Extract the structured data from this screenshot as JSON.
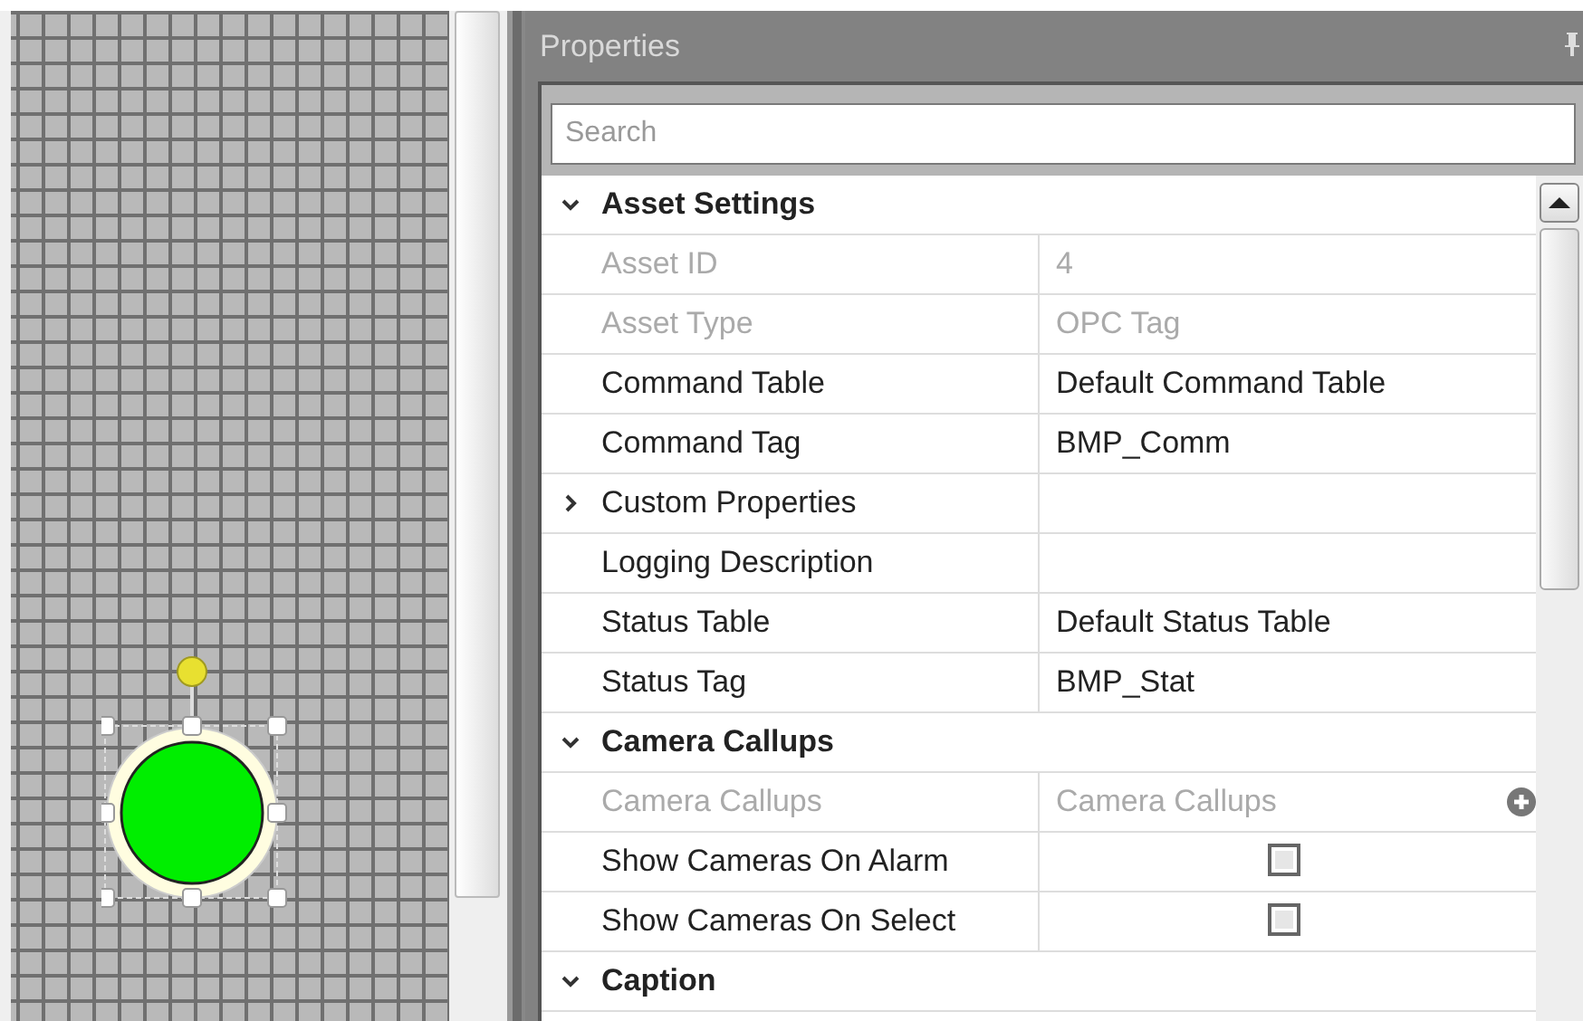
{
  "properties": {
    "title": "Properties",
    "search": {
      "placeholder": "Search"
    },
    "rows": [
      {
        "kind": "category",
        "label": "Asset Settings",
        "expanded": true
      },
      {
        "kind": "text",
        "label": "Asset ID",
        "value": "4",
        "disabled": true
      },
      {
        "kind": "text",
        "label": "Asset Type",
        "value": "OPC Tag",
        "disabled": true
      },
      {
        "kind": "text",
        "label": "Command Table",
        "value": "Default Command Table",
        "disabled": false
      },
      {
        "kind": "text",
        "label": "Command Tag",
        "value": "BMP_Comm",
        "disabled": false
      },
      {
        "kind": "group",
        "label": "Custom Properties",
        "expanded": false
      },
      {
        "kind": "text",
        "label": "Logging Description",
        "disabled": false
      },
      {
        "kind": "text",
        "label": "Status Table",
        "value": "Default Status Table",
        "disabled": false
      },
      {
        "kind": "text",
        "label": "Status Tag",
        "value": "BMP_Stat",
        "disabled": false
      },
      {
        "kind": "category",
        "label": "Camera Callups",
        "expanded": true
      },
      {
        "kind": "add",
        "label": "Camera Callups",
        "value": "Camera Callups",
        "disabled": true
      },
      {
        "kind": "checkbox",
        "label": "Show Cameras On Alarm",
        "checked": false,
        "disabled": false
      },
      {
        "kind": "checkbox",
        "label": "Show Cameras On Select",
        "checked": false,
        "disabled": false
      },
      {
        "kind": "category",
        "label": "Caption",
        "expanded": true
      }
    ]
  }
}
